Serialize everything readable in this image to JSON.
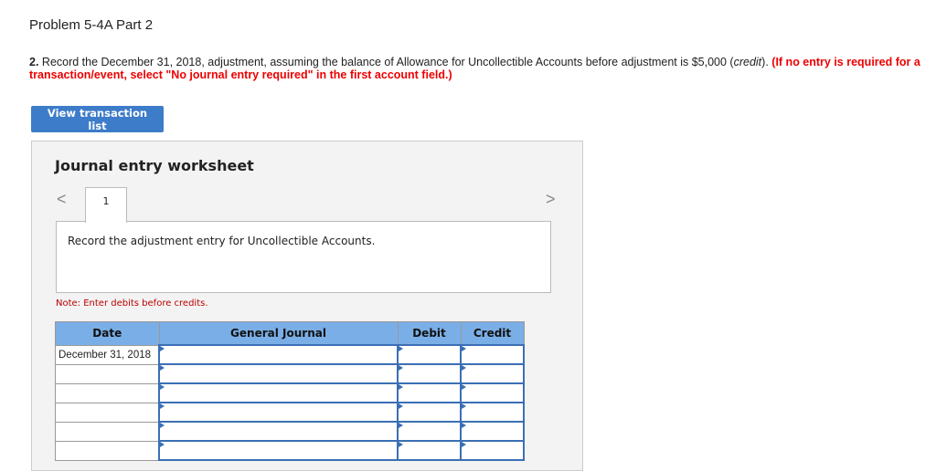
{
  "title": "Problem 5-4A Part 2",
  "instruction": {
    "number": "2.",
    "text": " Record the December 31, 2018, adjustment, assuming the balance of Allowance for Uncollectible Accounts before adjustment is $5,000 (",
    "italic": "credit",
    "text_end": "). ",
    "red": "(If no entry is required for a transaction/event, select \"No journal entry required\" in the first account field.)"
  },
  "view_button": "View transaction list",
  "worksheet": {
    "title": "Journal entry worksheet",
    "tab": "1",
    "description": "Record the adjustment entry for Uncollectible Accounts.",
    "note": "Note: Enter debits before credits.",
    "headers": [
      "Date",
      "General Journal",
      "Debit",
      "Credit"
    ],
    "rows": [
      {
        "date": "December 31, 2018"
      },
      {
        "date": ""
      },
      {
        "date": ""
      },
      {
        "date": ""
      },
      {
        "date": ""
      },
      {
        "date": ""
      }
    ]
  }
}
